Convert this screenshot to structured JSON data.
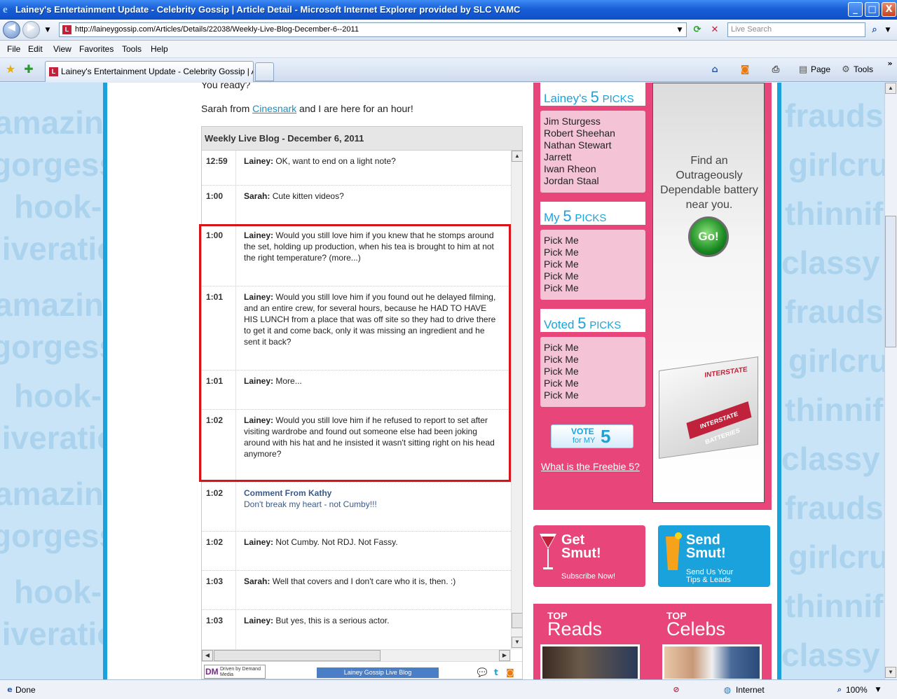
{
  "window": {
    "title": "Lainey's Entertainment Update - Celebrity Gossip | Article Detail - Microsoft Internet Explorer provided by SLC VAMC",
    "min": "_",
    "max": "□",
    "close": "X"
  },
  "address": {
    "url": "http://laineygossip.com/Articles/Details/22038/Weekly-Live-Blog-December-6--2011",
    "search_placeholder": "Live Search"
  },
  "menu": [
    "File",
    "Edit",
    "View",
    "Favorites",
    "Tools",
    "Help"
  ],
  "tab": {
    "label": "Lainey's Entertainment Update - Celebrity Gossip | Art..."
  },
  "commandbar": {
    "page": "Page",
    "tools": "Tools"
  },
  "intro": {
    "top_text": "You ready?",
    "line_before": "Sarah from ",
    "link": "Cinesnark",
    "line_after": " and I are here for an hour!"
  },
  "blog": {
    "title": "Weekly Live Blog - December 6, 2011",
    "entries": [
      {
        "time": "12:59",
        "author": "Lainey:",
        "text": " OK, want to end on a light note?"
      },
      {
        "time": "1:00",
        "author": "Sarah:",
        "text": " Cute kitten videos?"
      },
      {
        "time": "1:00",
        "author": "Lainey:",
        "text": " Would you still love him if you knew that he stomps around the set, holding up production, when his tea is brought to him at not the right temperature? (more...)"
      },
      {
        "time": "1:01",
        "author": "Lainey:",
        "text": " Would you still love him if you found out he delayed filming, and an entire crew, for several hours, because he HAD TO HAVE HIS LUNCH from a place that was off site so they had to drive there to get it and come back, only it was missing an ingredient and he sent it back?"
      },
      {
        "time": "1:01",
        "author": "Lainey:",
        "text": " More..."
      },
      {
        "time": "1:02",
        "author": "Lainey:",
        "text": " Would you still love him if he refused to report to set after visiting wardrobe and found out someone else had been joking around with his hat and he insisted it wasn't sitting right on his head anymore?"
      },
      {
        "time": "1:02",
        "author": "Comment From Kathy",
        "text": "Don't break my heart - not Cumby!!!"
      },
      {
        "time": "1:02",
        "author": "Lainey:",
        "text": " Not Cumby. Not RDJ. Not Fassy."
      },
      {
        "time": "1:03",
        "author": "Sarah:",
        "text": " Well that covers and I don't care who it is, then. :)"
      },
      {
        "time": "1:03",
        "author": "Lainey:",
        "text": " But yes, this is a serious actor."
      }
    ],
    "footer_brand": "Driven by Demand Media",
    "footer_logo": "Lainey Gossip Live Blog"
  },
  "sidebar": {
    "laineys": {
      "name": "Lainey's",
      "num": "5",
      "picks": "PICKS",
      "items": [
        "Jim Sturgess",
        "Robert Sheehan",
        "Nathan Stewart Jarrett",
        "Iwan Rheon",
        "Jordan Staal"
      ]
    },
    "my": {
      "name": "My",
      "num": "5",
      "picks": "PICKS",
      "items": [
        "Pick Me",
        "Pick Me",
        "Pick Me",
        "Pick Me",
        "Pick Me"
      ]
    },
    "voted": {
      "name": "Voted",
      "num": "5",
      "picks": "PICKS",
      "items": [
        "Pick Me",
        "Pick Me",
        "Pick Me",
        "Pick Me",
        "Pick Me"
      ]
    },
    "vote_button": {
      "line1": "VOTE",
      "line2": "for MY",
      "num": "5"
    },
    "freebie_link": "What is the Freebie 5?"
  },
  "ad": {
    "text": "Find an Outrageously Dependable battery near you.",
    "go": "Go!",
    "brand": "INTERSTATE",
    "brand2": "INTERSTATE BATTERIES"
  },
  "promo": {
    "get": {
      "title1": "Get",
      "title2": "Smut!",
      "sub": "Subscribe Now!"
    },
    "send": {
      "title1": "Send",
      "title2": "Smut!",
      "sub1": "Send Us Your",
      "sub2": "Tips & Leads"
    }
  },
  "top": {
    "reads_top": "TOP",
    "reads": "Reads",
    "celebs_top": "TOP",
    "celebs": "Celebs"
  },
  "status": {
    "text": "Done",
    "zone": "Internet",
    "zoom": "100%"
  },
  "colors": {
    "accent_pink": "#e8467a",
    "accent_blue": "#1aa2dd",
    "highlight_red": "#d9131a"
  }
}
